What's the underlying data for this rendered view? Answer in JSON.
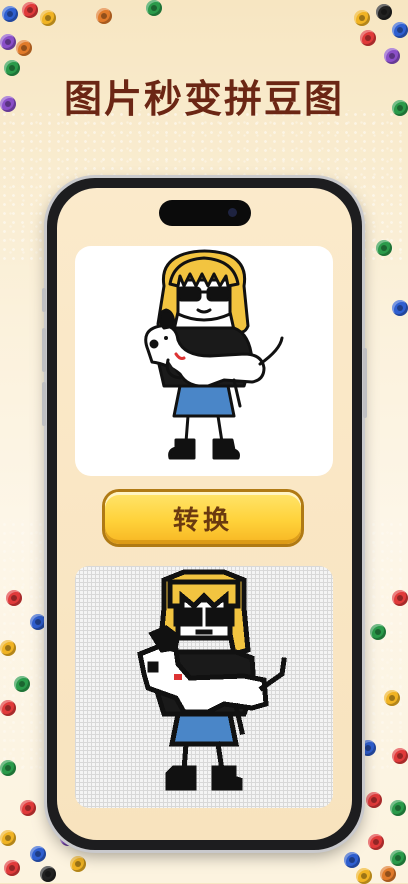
{
  "headline": "图片秒变拼豆图",
  "convert_button": {
    "label": "转换"
  },
  "colors": {
    "headline": "#6b2614",
    "button": "#ffd23a",
    "hair": "#f2c440",
    "jacket": "#1a1a1a",
    "skirt": "#4a86c8"
  },
  "icons": {
    "original": "girl-with-dog-illustration",
    "converted": "pixel-bead-girl-with-dog"
  }
}
